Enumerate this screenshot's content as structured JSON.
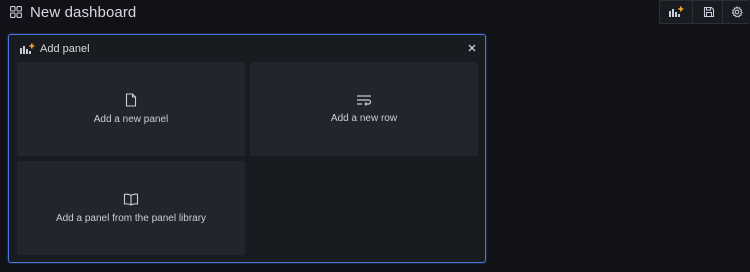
{
  "header": {
    "title": "New dashboard",
    "icons": {
      "dashboard": "apps-grid-icon",
      "add_panel": "add-panel-icon",
      "save": "save-icon",
      "settings": "gear-icon"
    }
  },
  "add_panel": {
    "title": "Add panel",
    "close_icon": "close-icon",
    "options": [
      {
        "label": "Add a new panel",
        "icon": "file-icon"
      },
      {
        "label": "Add a new row",
        "icon": "row-wrap-icon"
      },
      {
        "label": "Add a panel from the panel library",
        "icon": "book-icon"
      }
    ]
  },
  "colors": {
    "background": "#111217",
    "panel_border": "#4a74d9",
    "accent_orange": "#f5a623",
    "tile": "#22252b"
  }
}
